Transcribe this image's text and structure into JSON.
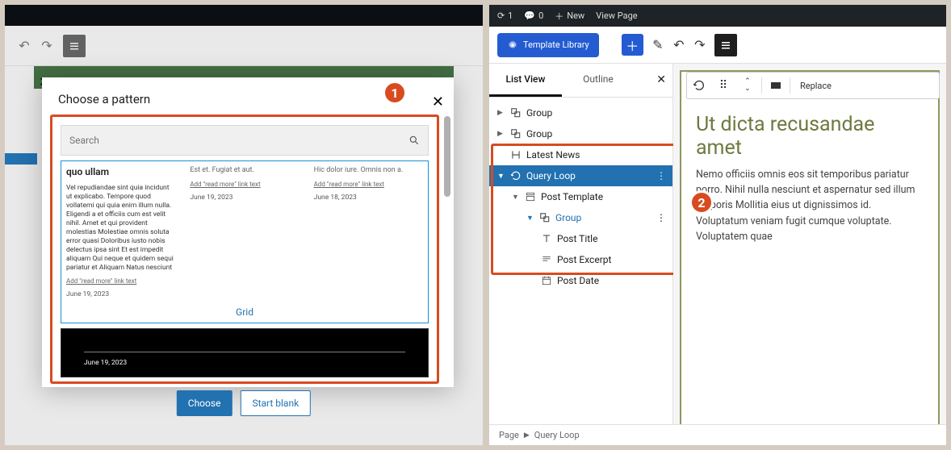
{
  "left": {
    "modal_title": "Choose a pattern",
    "search_placeholder": "Search",
    "pattern_label": "Grid",
    "col1": {
      "title": "quo ullam",
      "body": "Vel repudiandae sint quia incidunt ut explicabo. Tempore quod vollatemi qui quia enim illum nulla. Eligendi a et officiis cum est velit nihil. Amet et qui provident molestias Molestiae omnis soluta error quasi Doloribus iusto nobis delectus ipsa sint Et est impedit aliquam Qui neque et quidem sequi pariatur et Aliquam Natus nesciunt",
      "link": "Add \"read more\" link text",
      "date": "June 19, 2023"
    },
    "col2": {
      "sub": "Est et. Fugiat et aut.",
      "link": "Add \"read more\" link text",
      "date": "June 19, 2023"
    },
    "col3": {
      "sub": "Hic dolor iure. Omnis non a.",
      "link": "Add \"read more\" link text",
      "date": "June 18, 2023"
    },
    "pattern2_date": "June 19, 2023",
    "choose": "Choose",
    "start_blank": "Start blank"
  },
  "right": {
    "admin": {
      "count": "1",
      "comments": "0",
      "new": "New",
      "view": "View Page"
    },
    "template_btn": "Template Library",
    "tabs": {
      "list": "List View",
      "outline": "Outline"
    },
    "tree": {
      "g1": "Group",
      "g2": "Group",
      "latest": "Latest News",
      "ql": "Query Loop",
      "pt": "Post Template",
      "g3": "Group",
      "ptitle": "Post Title",
      "pexcerpt": "Post Excerpt",
      "pdate": "Post Date"
    },
    "toolbar_replace": "Replace",
    "post_title": "Ut dicta recusandae amet",
    "post_body": "Nemo officiis omnis eos sit temporibus pariatur porro. Nihil nulla nesciunt et aspernatur sed illum corporis Mollitia eius ut dignissimos id. Voluptatum veniam fugit cumque voluptate. Voluptatem quae",
    "bc": {
      "p": "Page",
      "ql": "Query Loop"
    }
  },
  "badges": {
    "one": "1",
    "two": "2"
  }
}
